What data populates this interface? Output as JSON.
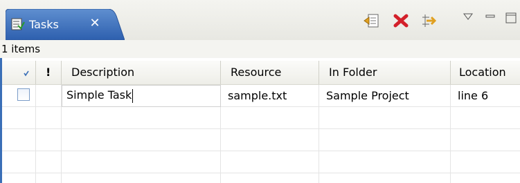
{
  "view": {
    "tab_title": "Tasks",
    "tab_icon": "tasks-icon",
    "close_icon": "close-icon",
    "toolbar": [
      {
        "name": "new-task-button",
        "icon": "new-task-icon"
      },
      {
        "name": "delete-button",
        "icon": "delete-icon"
      },
      {
        "name": "filter-button",
        "icon": "filter-icon"
      }
    ],
    "menu_icons": [
      "view-menu-icon",
      "minimize-icon",
      "maximize-icon"
    ]
  },
  "status": {
    "items_count": "1 items"
  },
  "table": {
    "columns": [
      "",
      "!",
      "Description",
      "Resource",
      "In Folder",
      "Location"
    ],
    "rows": [
      {
        "completed": false,
        "priority": "",
        "description": "Simple Task",
        "resource": "sample.txt",
        "folder": "Sample Project",
        "location": "line 6"
      }
    ]
  },
  "colors": {
    "tab_active": "#2f64b3",
    "table_border": "#3a6fb7",
    "delete_red": "#d3202a"
  }
}
